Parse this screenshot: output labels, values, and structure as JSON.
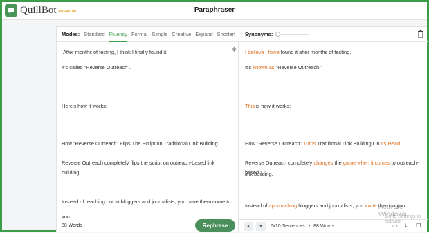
{
  "app": {
    "logo_text": "QuillBot",
    "logo_badge": "PREMIUM",
    "title": "Paraphraser"
  },
  "modes": {
    "label": "Modes:",
    "items": [
      "Standard",
      "Fluency",
      "Formal",
      "Simple",
      "Creative",
      "Expand",
      "Shorten"
    ],
    "active": "Fluency",
    "synonyms_label": "Synonyms:"
  },
  "input": {
    "paragraphs": [
      "After months of testing, I think I finally found it.",
      "It's called \"Reverse Outreach\".",
      "Here's how it works:",
      "How \"Reverse Outreach\" Flips The Script on Traditional Link Building",
      "Reverse Outreach completely flips the script on outreach-based link building.",
      "Instead of reaching out to bloggers and journalists, you have them come to",
      "you."
    ],
    "word_count": "88 Words",
    "rephrase_label": "Rephrase"
  },
  "output": {
    "p1_a": "I believe I have",
    "p1_b": " found it after months of testing.",
    "p2_a": "It's ",
    "p2_b": "known as",
    "p2_c": " \"Reverse Outreach.\"",
    "p3_a": "This",
    "p3_b": " is how it works:",
    "p4_a": "How \"Reverse Outreach\" ",
    "p4_b": "Turns",
    "p4_c": " Traditional Link Building On ",
    "p4_d": "Its Head",
    "p5_a": "Reverse Outreach completely ",
    "p5_b": "changes",
    "p5_c": " the ",
    "p5_d": "game",
    "p5_e": " ",
    "p5_f": "when it comes",
    "p5_g": " to outreach-based",
    "p5_h": "link building.",
    "p6_a": "Instead of ",
    "p6_b": "approaching",
    "p6_c": " bloggers and journalists, you ",
    "p6_d": "invite",
    "p6_e": " them to you.",
    "sentences": "5/10 Sentences",
    "dot": "•",
    "word_count": "88 Words"
  },
  "watermark": {
    "line1": "Activate Windows",
    "line2": "Go to Settings to activate"
  },
  "colors": {
    "brand_green": "#3d9c48",
    "changed_word": "#e0701f",
    "structure_change": "#3e6fd8"
  }
}
